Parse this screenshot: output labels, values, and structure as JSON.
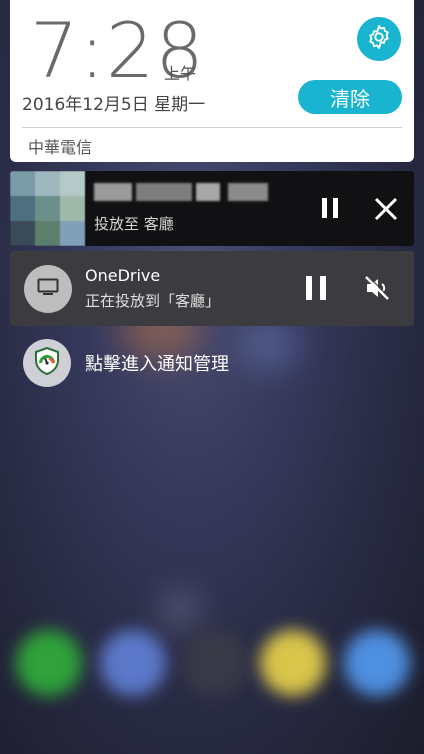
{
  "clock": {
    "time": "7:28",
    "ampm": "上午",
    "date": "2016年12月5日 星期一",
    "carrier": "中華電信"
  },
  "actions": {
    "clear_label": "清除",
    "settings_icon": "gear-icon"
  },
  "media_notification": {
    "subtitle": "投放至 客廳",
    "pause_icon": "pause-icon",
    "close_icon": "close-icon"
  },
  "onedrive_notification": {
    "title": "OneDrive",
    "subtitle": "正在投放到「客廳」",
    "app_icon": "tv-icon",
    "pause_icon": "pause-icon",
    "mute_icon": "volume-mute-icon"
  },
  "notification_manager": {
    "label": "點擊進入通知管理",
    "icon": "shield-gauge-icon"
  },
  "colors": {
    "accent": "#19b4d0",
    "card_white": "#ffffff",
    "media_bg": "#111113",
    "onedrive_bg": "#3c3c40"
  }
}
